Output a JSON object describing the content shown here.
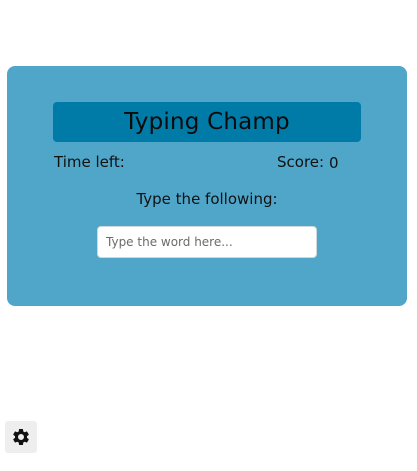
{
  "game": {
    "title": "Typing Champ",
    "time_label": "Time left:",
    "score_label": "Score:",
    "score_value": "0",
    "prompt_label": "Type the following:",
    "input": {
      "placeholder": "Type the word here...",
      "value": ""
    }
  },
  "settings": {
    "icon": "gear-icon"
  },
  "colors": {
    "panel": "#4fa6c9",
    "title_bar": "#007ba7",
    "settings_bg": "#eeeeee"
  }
}
